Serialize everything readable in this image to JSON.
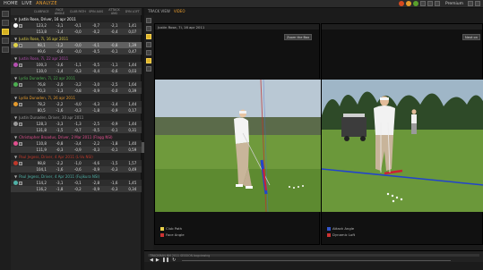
{
  "nav": [
    "HOME",
    "LIVE",
    "ANALYZE"
  ],
  "active_nav_index": 2,
  "premium_label": "Premium",
  "status_dots": [
    "#d64a1f",
    "#e59a2d",
    "#5aa02c"
  ],
  "column_headers": [
    "CLUBFACE",
    "FACE ANGLE",
    "CLUB PATH",
    "SPIN AXIS",
    "ATTACK ANG",
    "DYN LOFT"
  ],
  "sessions": [
    {
      "title": "Justin Rose, Driver, 16 apr 2011",
      "color": "#ffffff",
      "rows": [
        {
          "vals": [
            "123,2",
            "-3,1",
            "-0,1",
            "-0,7",
            "-2,1",
            "1,41"
          ],
          "style": "dark",
          "icon": true
        },
        {
          "vals": [
            "153,8",
            "-1,4",
            "-0,0",
            "-0,2",
            "-0,4",
            "0,07"
          ],
          "style": "light",
          "icon": false
        }
      ]
    },
    {
      "title": "Justin Rose, 7i, 16 apr 2011",
      "color": "#e1d447",
      "rows": [
        {
          "vals": [
            "98,1",
            "-1,2",
            "-0,0",
            "-4,1",
            "-0,8",
            "1,39"
          ],
          "style": "sel",
          "icon": true
        },
        {
          "vals": [
            "99,6",
            "-0,6",
            "-0,0",
            "-0,5",
            "-0,1",
            "0,47"
          ],
          "style": "light",
          "icon": false
        }
      ]
    },
    {
      "title": "Justin Rose, 7i, 22 apr 2011",
      "color": "#b64fb1",
      "rows": [
        {
          "vals": [
            "100,3",
            "-3,6",
            "-1,1",
            "-0,5",
            "-1,1",
            "1,44"
          ],
          "style": "dark",
          "icon": true
        },
        {
          "vals": [
            "110,0",
            "-1,4",
            "-0,3",
            "-0,4",
            "-0,6",
            "0,03"
          ],
          "style": "light",
          "icon": false
        }
      ]
    },
    {
      "title": "Lydia Dunaden, 7i, 22 apr 2011",
      "color": "#4caf50",
      "rows": [
        {
          "vals": [
            "76,8",
            "-2,0",
            "-3,2",
            "-3,0",
            "-2,5",
            "1,64"
          ],
          "style": "dark",
          "icon": true
        },
        {
          "vals": [
            "70,3",
            "-1,3",
            "-0,8",
            "-0,9",
            "-0,0",
            "0,39"
          ],
          "style": "light",
          "icon": false
        }
      ]
    },
    {
      "title": "Lydia Dunaden, 7i, 26 apr 2011",
      "color": "#e59a2d",
      "rows": [
        {
          "vals": [
            "78,2",
            "-2,2",
            "-4,0",
            "-4,3",
            "-3,4",
            "1,44"
          ],
          "style": "dark",
          "icon": true
        },
        {
          "vals": [
            "80,5",
            "-1,6",
            "-0,3",
            "-1,8",
            "-0,9",
            "0,17"
          ],
          "style": "light",
          "icon": false
        }
      ]
    },
    {
      "title": "Justin Dunaden, Driver, 30 apr 2011",
      "color": "#9b9b9b",
      "rows": [
        {
          "vals": [
            "128,3",
            "-3,3",
            "-1,3",
            "-2,5",
            "-0,9",
            "1,44"
          ],
          "style": "dark",
          "icon": true
        },
        {
          "vals": [
            "131,8",
            "-1,5",
            "-0,7",
            "-0,5",
            "-0,1",
            "0,31"
          ],
          "style": "light",
          "icon": false
        }
      ]
    },
    {
      "title": "Christopher Broadus, Driver, 2 Mar 2011 (Flagg NSI)",
      "color": "#e1508f",
      "rows": [
        {
          "vals": [
            "110,8",
            "-0,8",
            "-3,4",
            "-2,2",
            "-1,8",
            "1,40"
          ],
          "style": "dark",
          "icon": true
        },
        {
          "vals": [
            "111,9",
            "-0,3",
            "-0,9",
            "-0,3",
            "-0,1",
            "0,59"
          ],
          "style": "light",
          "icon": false
        }
      ]
    },
    {
      "title": "Paul Jegess, Driver, 4 Apr 2011 (L-Vu NSI)",
      "color": "#c0392b",
      "rows": [
        {
          "vals": [
            "98,8",
            "-2,2",
            "-1,0",
            "-4,6",
            "-1,5",
            "1,57"
          ],
          "style": "dark",
          "icon": true
        },
        {
          "vals": [
            "104,1",
            "-1,6",
            "-0,6",
            "-0,9",
            "-0,3",
            "0,49"
          ],
          "style": "light",
          "icon": false
        }
      ]
    },
    {
      "title": "Paul Jegess, Driver, 4 Apr 2011 (Fujikura NSI)",
      "color": "#4fb1a7",
      "rows": [
        {
          "vals": [
            "114,2",
            "-3,1",
            "-0,1",
            "-2,8",
            "-1,6",
            "1,45"
          ],
          "style": "dark",
          "icon": true
        },
        {
          "vals": [
            "116,2",
            "-1,8",
            "-0,2",
            "-0,9",
            "-0,3",
            "0,34"
          ],
          "style": "light",
          "icon": false
        }
      ]
    }
  ],
  "right_tabs": [
    "TRACK VIEW",
    "VIDEO"
  ],
  "pane_left_title": "Justin Rose, 7i, 16 apr 2011",
  "zoom_button": "Zoom the Box",
  "pane_right_btn": "Next on",
  "legend_left": [
    {
      "label": "Club Path",
      "color": "#e8d04a"
    },
    {
      "label": "Face Angle",
      "color": "#cc3333"
    }
  ],
  "legend_right": [
    {
      "label": "Attack Angle",
      "color": "#3355cc"
    },
    {
      "label": "Dynamic Loft",
      "color": "#cc3333"
    }
  ],
  "timeline_label": "TRACKMAN NM 2011 SESSION  bagviewing"
}
